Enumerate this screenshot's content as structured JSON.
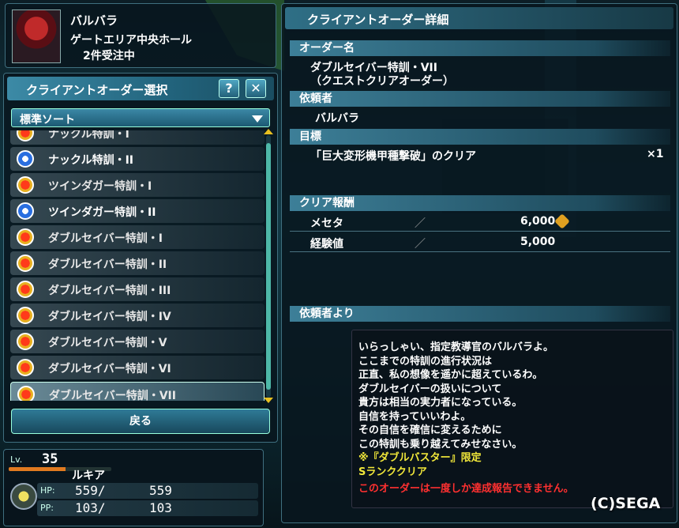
{
  "npc": {
    "name": "バルバラ",
    "location": "ゲートエリア中央ホール",
    "order_count": "2件受注中"
  },
  "order_select": {
    "title": "クライアントオーダー選択",
    "help_label": "?",
    "close_label": "✕",
    "sort_label": "標準ソート",
    "back_label": "戻る",
    "items": [
      {
        "label": "ナックル特訓・I",
        "icon": "crown-icon"
      },
      {
        "label": "ナックル特訓・II",
        "icon": "book-icon"
      },
      {
        "label": "ツインダガー特訓・I",
        "icon": "crown-icon"
      },
      {
        "label": "ツインダガー特訓・II",
        "icon": "book-icon"
      },
      {
        "label": "ダブルセイバー特訓・I",
        "icon": "crown-icon"
      },
      {
        "label": "ダブルセイバー特訓・II",
        "icon": "crown-icon"
      },
      {
        "label": "ダブルセイバー特訓・III",
        "icon": "crown-icon"
      },
      {
        "label": "ダブルセイバー特訓・IV",
        "icon": "crown-icon"
      },
      {
        "label": "ダブルセイバー特訓・V",
        "icon": "crown-icon"
      },
      {
        "label": "ダブルセイバー特訓・VI",
        "icon": "crown-icon"
      },
      {
        "label": "ダブルセイバー特訓・VII",
        "icon": "crown-icon",
        "selected": true
      }
    ]
  },
  "player": {
    "level_label": "Lv.",
    "level": "35",
    "exp_fraction": 0.55,
    "name": "ルキア",
    "hp_label": "HP:",
    "hp_current": "559/",
    "hp_max": "559",
    "pp_label": "PP:",
    "pp_current": "103/",
    "pp_max": "103"
  },
  "detail": {
    "title": "クライアントオーダー詳細",
    "order_name_head": "オーダー名",
    "order_name_line1": "ダブルセイバー特訓・VII",
    "order_name_line2": "（クエストクリアオーダー）",
    "client_head": "依頼者",
    "client_name": "バルバラ",
    "target_head": "目標",
    "target_text": "「巨大変形機甲種撃破」のクリア",
    "target_count": "×1",
    "reward_head": "クリア報酬",
    "rewards": [
      {
        "name": "メセタ",
        "slash": "／",
        "value": "6,000"
      },
      {
        "name": "経験値",
        "slash": "／",
        "value": "5,000"
      }
    ],
    "message_head": "依頼者より",
    "message_lines": [
      {
        "text": "いらっしゃい、指定教導官のバルバラよ。",
        "color": "#ffffff"
      },
      {
        "text": "ここまでの特訓の進行状況は",
        "color": "#ffffff"
      },
      {
        "text": "正直、私の想像を遥かに超えているわ。",
        "color": "#ffffff"
      },
      {
        "text": "ダブルセイバーの扱いについて",
        "color": "#ffffff"
      },
      {
        "text": "貴方は相当の実力者になっている。",
        "color": "#ffffff"
      },
      {
        "text": "自信を持っていいわよ。",
        "color": "#ffffff"
      },
      {
        "text": "その自信を確信に変えるために",
        "color": "#ffffff"
      },
      {
        "text": "この特訓も乗り越えてみせなさい。",
        "color": "#ffffff"
      },
      {
        "text": "※『ダブルバスター』限定",
        "color": "#f2e83a"
      },
      {
        "text": "Sランククリア",
        "color": "#f2e83a"
      },
      {
        "text": "このオーダーは一度しか達成報告できません。",
        "color": "#ff3030"
      }
    ]
  },
  "copyright": "(C)SEGA"
}
